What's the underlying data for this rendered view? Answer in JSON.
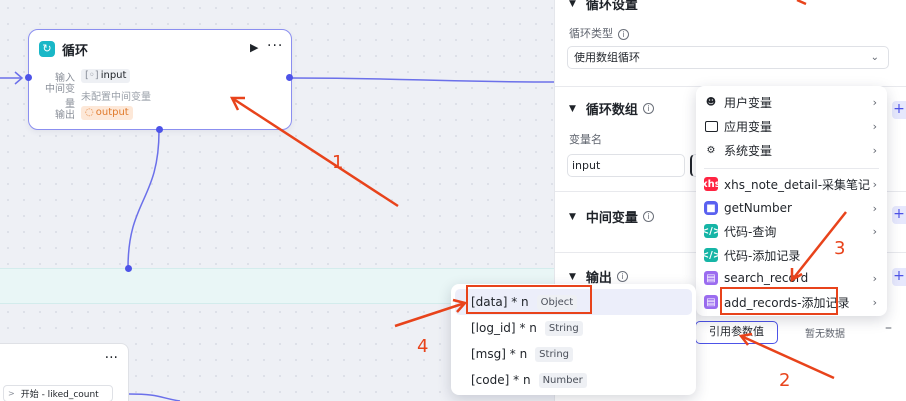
{
  "loop_node": {
    "title": "循环",
    "run_icon": "▶",
    "more_icon": "···",
    "params": [
      {
        "key": "输入",
        "prefix": "[◦]",
        "value": "input"
      },
      {
        "key": "中间变量",
        "value": "未配置中间变量"
      },
      {
        "key": "输出",
        "prefix": "◌",
        "value": "output"
      }
    ]
  },
  "lower_node": {
    "more_icon": "···",
    "row_text": "开始 - liked_count"
  },
  "panel": {
    "top_title": "循环设置",
    "loop_type_label": "循环类型",
    "loop_type_value": "使用数组循环",
    "loop_array_title": "循环数组",
    "var_name_label": "变量名",
    "var_name_value": "input",
    "mid_var_title": "中间变量",
    "output_title": "输出",
    "ref_button": "引用参数值",
    "no_data": "暂无数据"
  },
  "menu": {
    "items": [
      {
        "label": "用户变量",
        "icon": "user-icon"
      },
      {
        "label": "应用变量",
        "icon": "folder-icon"
      },
      {
        "label": "系统变量",
        "icon": "gear-icon"
      },
      {
        "label": "xhs_note_detail-采集笔记",
        "icon": "xhs-icon",
        "icon_text": "xhs"
      },
      {
        "label": "getNumber",
        "icon": "number-icon"
      },
      {
        "label": "代码-查询",
        "icon": "code-icon"
      },
      {
        "label": "代码-添加记录",
        "icon": "code-icon"
      },
      {
        "label": "search_record",
        "icon": "database-icon"
      },
      {
        "label": "add_records-添加记录",
        "icon": "database-icon"
      }
    ]
  },
  "submenu": {
    "items": [
      {
        "name": "[data]",
        "mark": "* n",
        "type": "Object"
      },
      {
        "name": "[log_id]",
        "mark": "* n",
        "type": "String"
      },
      {
        "name": "[msg]",
        "mark": "* n",
        "type": "String"
      },
      {
        "name": "[code]",
        "mark": "* n",
        "type": "Number"
      }
    ]
  },
  "annotations": {
    "labels": [
      "1",
      "2",
      "3",
      "4"
    ],
    "color": "#e8431b"
  }
}
